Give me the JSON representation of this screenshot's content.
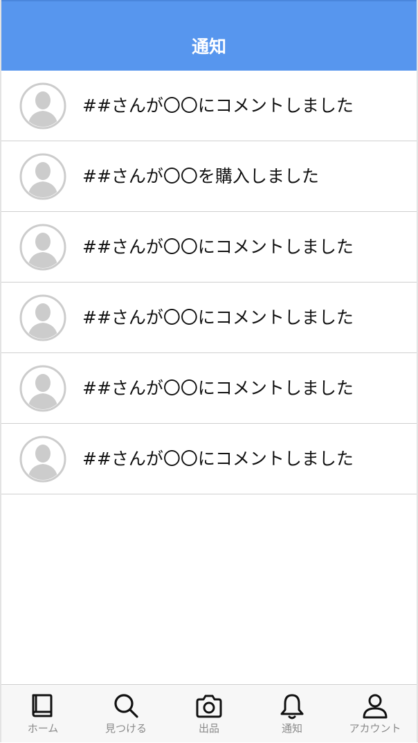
{
  "header": {
    "title": "通知"
  },
  "notifications": [
    {
      "message": "##さんが〇〇にコメントしました",
      "avatar_icon": "user-avatar-icon"
    },
    {
      "message": "##さんが〇〇を購入しました",
      "avatar_icon": "user-avatar-icon"
    },
    {
      "message": "##さんが〇〇にコメントしました",
      "avatar_icon": "user-avatar-icon"
    },
    {
      "message": "##さんが〇〇にコメントしました",
      "avatar_icon": "user-avatar-icon"
    },
    {
      "message": "##さんが〇〇にコメントしました",
      "avatar_icon": "user-avatar-icon"
    },
    {
      "message": "##さんが〇〇にコメントしました",
      "avatar_icon": "user-avatar-icon"
    }
  ],
  "tabbar": {
    "home": {
      "label": "ホーム",
      "icon": "book-icon"
    },
    "search": {
      "label": "見つける",
      "icon": "search-icon"
    },
    "sell": {
      "label": "出品",
      "icon": "camera-icon"
    },
    "notifications": {
      "label": "通知",
      "icon": "bell-icon"
    },
    "account": {
      "label": "アカウント",
      "icon": "user-icon"
    }
  },
  "colors": {
    "header_bg": "#5796ee",
    "header_text": "#ffffff",
    "tab_label": "#8a8a8a",
    "avatar_gray": "#cccccc"
  }
}
